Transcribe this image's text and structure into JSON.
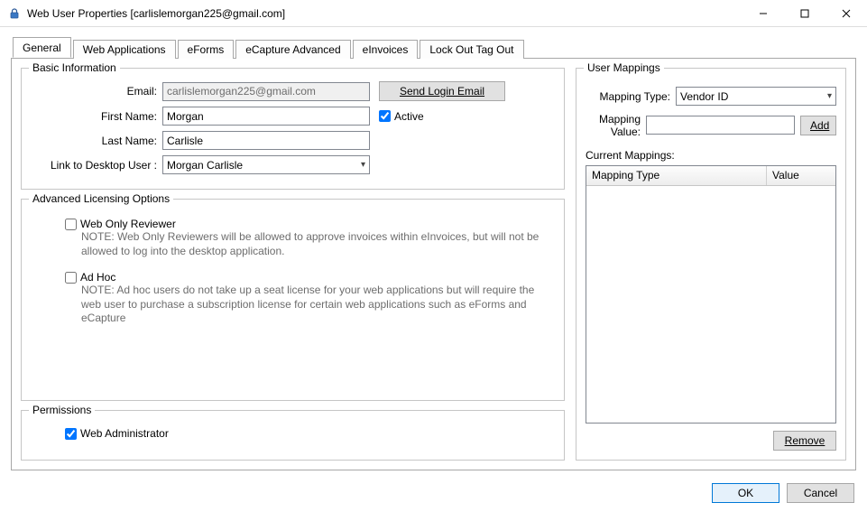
{
  "window": {
    "title": "Web User Properties [carlislemorgan225@gmail.com]"
  },
  "tabs": [
    {
      "label": "General"
    },
    {
      "label": "Web Applications"
    },
    {
      "label": "eForms"
    },
    {
      "label": "eCapture Advanced"
    },
    {
      "label": "eInvoices"
    },
    {
      "label": "Lock Out Tag Out"
    }
  ],
  "basic_info": {
    "legend": "Basic Information",
    "email_label": "Email:",
    "email_value": "carlislemorgan225@gmail.com",
    "send_login_label": "Send Login Email",
    "first_name_label": "First Name:",
    "first_name_value": "Morgan",
    "active_label": "Active",
    "last_name_label": "Last Name:",
    "last_name_value": "Carlisle",
    "link_label": "Link to Desktop User :",
    "link_value": "Morgan  Carlisle"
  },
  "advanced": {
    "legend": "Advanced Licensing Options",
    "web_only_label": "Web Only Reviewer",
    "web_only_note": "NOTE: Web Only Reviewers will be allowed to approve invoices within eInvoices, but will not be allowed to log into the desktop application.",
    "adhoc_label": "Ad Hoc",
    "adhoc_note": "NOTE: Ad hoc users do not take up a seat license for your web applications but will require the web user to purchase a subscription license for certain web applications such as eForms and eCapture"
  },
  "permissions": {
    "legend": "Permissions",
    "web_admin_label": "Web Administrator"
  },
  "mappings": {
    "legend": "User Mappings",
    "type_label": "Mapping Type:",
    "type_value": "Vendor ID",
    "value_label": "Mapping Value:",
    "value_value": "",
    "add_label": "Add",
    "current_label": "Current Mappings:",
    "col_type": "Mapping Type",
    "col_value": "Value",
    "remove_label": "Remove"
  },
  "dialog": {
    "ok_label": "OK",
    "cancel_label": "Cancel"
  }
}
